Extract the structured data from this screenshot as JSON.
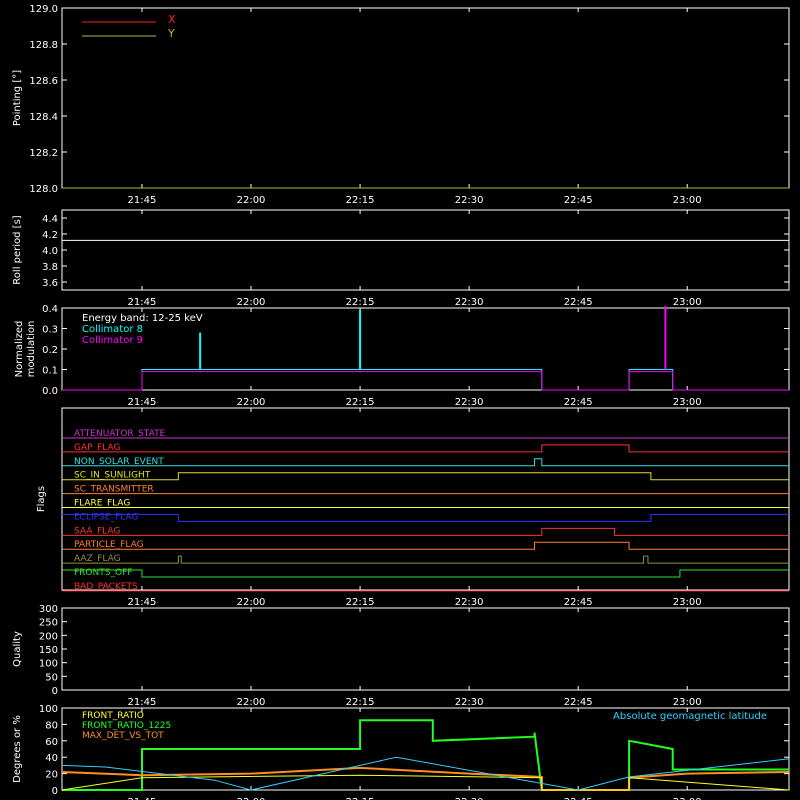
{
  "x_ticks": [
    "21:45",
    "22:00",
    "22:15",
    "22:30",
    "22:45",
    "23:00"
  ],
  "chart_data": [
    {
      "type": "line",
      "ylabel": "Pointing [°]",
      "ylim": [
        128.0,
        129.0
      ],
      "y_ticks": [
        "128.0",
        "128.2",
        "128.4",
        "128.6",
        "128.8",
        "129.0"
      ],
      "legend": [
        {
          "name": "X",
          "color": "#ff2020"
        },
        {
          "name": "Y",
          "color": "#b8b830"
        }
      ],
      "series": [
        {
          "name": "X",
          "color": "#ff2020",
          "x": [
            "21:34",
            "23:14"
          ],
          "values": [
            128.0,
            128.0
          ]
        },
        {
          "name": "Y",
          "color": "#b8b830",
          "x": [
            "21:34",
            "23:14"
          ],
          "values": [
            128.0,
            128.0
          ]
        }
      ]
    },
    {
      "type": "line",
      "ylabel": "Roll period [s]",
      "ylim": [
        3.5,
        4.5
      ],
      "y_ticks": [
        "3.6",
        "3.8",
        "4.0",
        "4.2",
        "4.4"
      ],
      "series": [
        {
          "color": "#ffffff",
          "x": [
            "21:34",
            "23:14"
          ],
          "values": [
            4.12,
            4.12
          ]
        }
      ]
    },
    {
      "type": "line",
      "ylabel": "Normalized modulation",
      "ylim": [
        0.0,
        0.4
      ],
      "y_ticks": [
        "0.0",
        "0.1",
        "0.2",
        "0.3",
        "0.4"
      ],
      "legend": [
        {
          "name": "Energy band: 12-25 keV",
          "color": "#ffffff"
        },
        {
          "name": "Collimator 8",
          "color": "#00ffff"
        },
        {
          "name": "Collimator 9",
          "color": "#ff00ff"
        }
      ],
      "series": [
        {
          "name": "Collimator 8",
          "color": "#00ffff",
          "x": [
            "21:34",
            "21:45",
            "21:45",
            "22:40",
            "22:40",
            "22:52",
            "22:52",
            "22:58",
            "22:58",
            "23:14"
          ],
          "values": [
            0,
            0,
            0.1,
            0.1,
            0,
            0,
            0.1,
            0.1,
            0,
            0
          ]
        },
        {
          "name": "Collimator 9",
          "color": "#ff00ff",
          "x": [
            "21:34",
            "21:45",
            "21:45",
            "22:40",
            "22:40",
            "22:52",
            "22:52",
            "22:58",
            "22:58",
            "23:14"
          ],
          "values": [
            0,
            0,
            0.09,
            0.09,
            0,
            0,
            0.09,
            0.09,
            0,
            0
          ]
        }
      ],
      "spikes": [
        {
          "x": "22:15",
          "value": 0.39,
          "color": "#00ffff"
        },
        {
          "x": "22:57",
          "value": 0.41,
          "color": "#ff00ff"
        },
        {
          "x": "21:53",
          "value": 0.28,
          "color": "#00ffff"
        }
      ]
    },
    {
      "type": "line",
      "ylabel": "Flags",
      "flags": [
        {
          "name": "ATTENUATOR_STATE",
          "color": "#cc33cc",
          "steps": []
        },
        {
          "name": "GAP_FLAG",
          "color": "#ff3030",
          "steps": [
            [
              "22:40",
              "22:52"
            ]
          ]
        },
        {
          "name": "NON_SOLAR_EVENT",
          "color": "#30e0e0",
          "steps": [
            [
              "22:39",
              "22:40"
            ]
          ]
        },
        {
          "name": "SC_IN_SUNLIGHT",
          "color": "#e0e020",
          "steps": [
            [
              "21:50",
              "22:55"
            ]
          ]
        },
        {
          "name": "SC_TRANSMITTER",
          "color": "#ff8030",
          "steps": []
        },
        {
          "name": "FLARE_FLAG",
          "color": "#ffff40",
          "steps": []
        },
        {
          "name": "ECLIPSE_FLAG",
          "color": "#3030ff",
          "inverted": true,
          "steps": [
            [
              "21:50",
              "22:55"
            ]
          ]
        },
        {
          "name": "SAA_FLAG",
          "color": "#ff3030",
          "steps": [
            [
              "22:40",
              "22:50"
            ]
          ]
        },
        {
          "name": "PARTICLE_FLAG",
          "color": "#ff8030",
          "steps": [
            [
              "22:39",
              "22:52"
            ]
          ]
        },
        {
          "name": "AAZ_FLAG",
          "color": "#909040",
          "steps": [
            [
              "21:50",
              "21:50.4"
            ],
            [
              "22:54",
              "22:54.6"
            ]
          ]
        },
        {
          "name": "FRONTS_OFF",
          "color": "#30e030",
          "inverted": true,
          "steps": [
            [
              "21:45",
              "22:59"
            ]
          ]
        },
        {
          "name": "BAD_PACKETS",
          "color": "#ff3030",
          "steps": []
        }
      ]
    },
    {
      "type": "line",
      "ylabel": "Quality",
      "ylim": [
        0,
        300
      ],
      "y_ticks": [
        "0",
        "50",
        "100",
        "150",
        "200",
        "250",
        "300"
      ],
      "series": [
        {
          "color": "#ffffff",
          "x": [
            "21:34",
            "23:14"
          ],
          "values": [
            0,
            0
          ]
        }
      ]
    },
    {
      "type": "line",
      "ylabel": "Degrees or %",
      "ylim": [
        0,
        100
      ],
      "y_ticks": [
        "0",
        "20",
        "40",
        "60",
        "80",
        "100"
      ],
      "legend": [
        {
          "name": "FRONT_RATIO",
          "color": "#ffff20"
        },
        {
          "name": "FRONT_RATIO_1225",
          "color": "#20ff20"
        },
        {
          "name": "MAX_DET_VS_TOT",
          "color": "#ff9020"
        },
        {
          "name": "Absolute geomagnetic latitude",
          "color": "#30d0ff"
        }
      ],
      "series": [
        {
          "name": "FRONT_RATIO_1225",
          "color": "#20ff20",
          "x": [
            "21:34",
            "21:45",
            "21:45",
            "22:15",
            "22:15",
            "22:25",
            "22:25",
            "22:39",
            "22:39",
            "22:40",
            "22:40",
            "22:52",
            "22:52",
            "22:58",
            "22:58",
            "23:14"
          ],
          "values": [
            0,
            0,
            50,
            50,
            85,
            85,
            60,
            65,
            70,
            0,
            0,
            0,
            60,
            50,
            25,
            25
          ]
        },
        {
          "name": "MAX_DET_VS_TOT",
          "color": "#ff9020",
          "x": [
            "21:34",
            "21:45",
            "22:00",
            "22:15",
            "22:30",
            "22:40",
            "22:40",
            "22:52",
            "22:52",
            "23:00",
            "23:14"
          ],
          "values": [
            22,
            18,
            20,
            27,
            20,
            16,
            0,
            0,
            15,
            20,
            22
          ]
        },
        {
          "name": "FRONT_RATIO",
          "color": "#ffff20",
          "x": [
            "21:34",
            "21:45",
            "22:15",
            "22:40",
            "22:40",
            "22:52",
            "22:52",
            "23:14"
          ],
          "values": [
            0,
            15,
            18,
            15,
            0,
            0,
            15,
            0
          ]
        },
        {
          "name": "Absolute geomagnetic latitude",
          "color": "#30d0ff",
          "x": [
            "21:34",
            "21:40",
            "21:55",
            "22:00",
            "22:20",
            "22:45",
            "22:52",
            "23:14"
          ],
          "values": [
            30,
            28,
            12,
            0,
            40,
            0,
            16,
            38
          ]
        }
      ]
    }
  ]
}
